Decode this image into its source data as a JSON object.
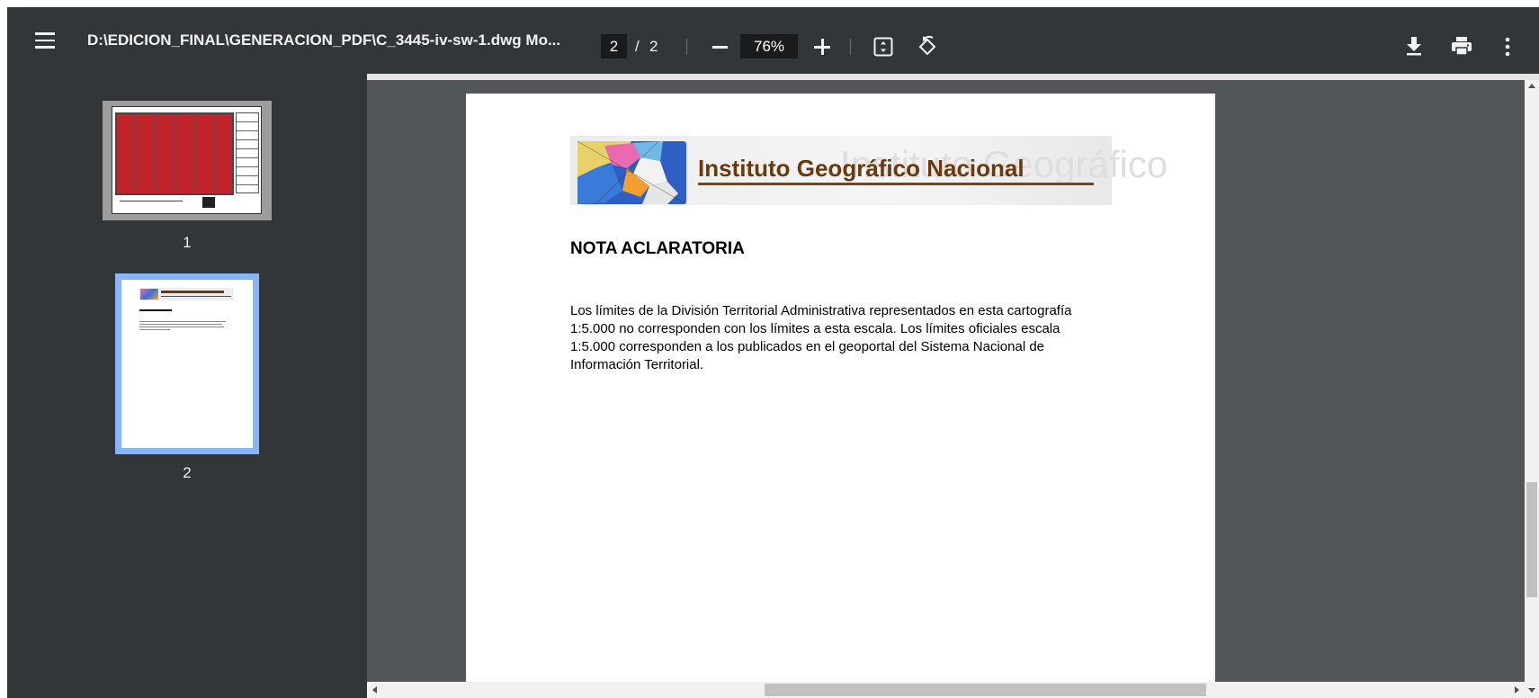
{
  "toolbar": {
    "menu_icon": "hamburger-icon",
    "title": "D:\\EDICION_FINAL\\GENERACION_PDF\\C_3445-iv-sw-1.dwg Mo...",
    "current_page": "2",
    "separator": "/",
    "total_pages": "2",
    "zoom": "76%",
    "icons": [
      "zoom-out-icon",
      "zoom-in-icon",
      "fit-page-icon",
      "rotate-icon",
      "download-icon",
      "print-icon",
      "more-icon"
    ]
  },
  "sidebar": {
    "thumbnails": [
      {
        "label": "1",
        "selected": false
      },
      {
        "label": "2",
        "selected": true
      }
    ]
  },
  "document": {
    "banner_title": "Instituto Geográfico Nacional",
    "banner_ghost": "Instituto Geográfico",
    "heading": "NOTA ACLARATORIA",
    "paragraph": "Los límites de la División Territorial Administrativa representados en esta cartografía 1:5.000 no corresponden con los límites a esta escala. Los  límites oficiales escala 1:5.000 corresponden a los publicados en el geoportal del Sistema Nacional de Información Territorial."
  },
  "colors": {
    "toolbar_bg": "#323639",
    "viewer_bg": "#525659",
    "selected_thumb_border": "#8ab4f8",
    "brand_brown": "#6a3a0e"
  }
}
